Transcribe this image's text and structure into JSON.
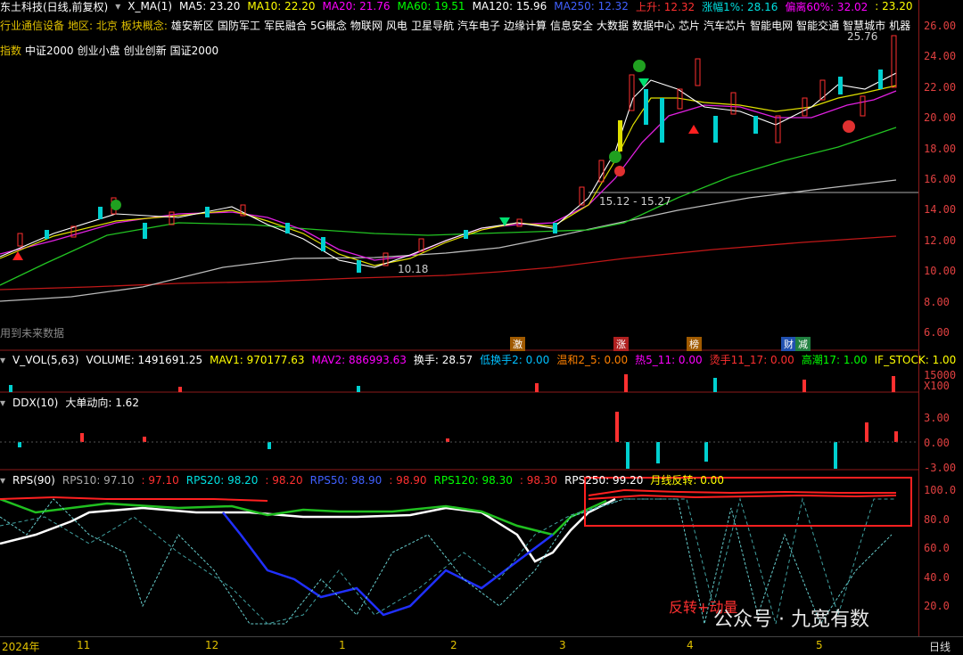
{
  "header": {
    "stock": "东土科技(日线,前复权)",
    "ma_label": "X_MA(1)",
    "ma_items": [
      {
        "text": "MA5: 23.20",
        "color": "#ffffff"
      },
      {
        "text": "MA10: 22.20",
        "color": "#ffff00"
      },
      {
        "text": "MA20: 21.76",
        "color": "#ff00ff"
      },
      {
        "text": "MA60: 19.51",
        "color": "#00ff00"
      },
      {
        "text": "MA120: 15.96",
        "color": "#ffffff"
      },
      {
        "text": "MA250: 12.32",
        "color": "#4060ff"
      },
      {
        "text": "上升: 12.32",
        "color": "#ff3030"
      },
      {
        "text": "涨幅1%: 28.16",
        "color": "#00e0e0"
      },
      {
        "text": "偏离60%: 32.02",
        "color": "#ff00ff"
      },
      {
        "text": ": 23.20",
        "color": "#ffff00"
      }
    ]
  },
  "sectors": {
    "industry": "行业通信设备",
    "region": "地区: 北京",
    "concept_prefix": "板块概念:",
    "concepts": [
      "雄安新区",
      "国防军工",
      "军民融合",
      "5G概念",
      "物联网",
      "风电",
      "卫星导航",
      "汽车电子",
      "边缘计算",
      "信息安全",
      "大数据",
      "数据中心",
      "芯片",
      "汽车芯片",
      "智能电网",
      "智能交通",
      "智慧城市",
      "机器"
    ],
    "index_label": "指数",
    "indices": [
      "中证2000",
      "创业小盘",
      "创业创新",
      "国证2000"
    ]
  },
  "main_chart": {
    "price_axis": [
      "26.00",
      "24.00",
      "22.00",
      "20.00",
      "18.00",
      "16.00",
      "14.00",
      "12.00",
      "10.00",
      "8.00",
      "6.00"
    ],
    "high_label": "25.76",
    "range_label": "15.12 - 15.27",
    "low_label": "10.18",
    "future_note": "用到未来数据",
    "tags": [
      {
        "text": "激",
        "bg": "#a05a00"
      },
      {
        "text": "涨",
        "bg": "#b02020"
      },
      {
        "text": "榜",
        "bg": "#a05a00"
      },
      {
        "text": "财",
        "bg": "#2050b0"
      },
      {
        "text": "减",
        "bg": "#208040"
      }
    ]
  },
  "volume": {
    "label": "V_VOL(5,63)",
    "items": [
      {
        "text": "VOLUME: 1491691.25",
        "color": "#ffffff"
      },
      {
        "text": "MAV1: 970177.63",
        "color": "#ffff00"
      },
      {
        "text": "MAV2: 886993.63",
        "color": "#ff00ff"
      },
      {
        "text": "换手: 28.57",
        "color": "#ffffff"
      },
      {
        "text": "低换手2: 0.00",
        "color": "#00c0ff"
      },
      {
        "text": "温和2_5: 0.00",
        "color": "#ff8000"
      },
      {
        "text": "热5_11: 0.00",
        "color": "#ff00ff"
      },
      {
        "text": "烫手11_17: 0.00",
        "color": "#ff3030"
      },
      {
        "text": "高潮17: 1.00",
        "color": "#00ff00"
      },
      {
        "text": "IF_STOCK: 1.00",
        "color": "#ffff00"
      }
    ],
    "axis": "15000",
    "unit": "X100"
  },
  "ddx": {
    "label": "DDX(10)",
    "item": "大单动向: 1.62",
    "axis": [
      "3.00",
      "0.00",
      "-3.00"
    ]
  },
  "rps": {
    "label": "RPS(90)",
    "items": [
      {
        "text": "RPS10: 97.10",
        "color": "#aaaaaa"
      },
      {
        "text": ": 97.10",
        "color": "#ff3030"
      },
      {
        "text": "RPS20: 98.20",
        "color": "#00e0e0"
      },
      {
        "text": ": 98.20",
        "color": "#ff3030"
      },
      {
        "text": "RPS50: 98.90",
        "color": "#4060ff"
      },
      {
        "text": ": 98.90",
        "color": "#ff3030"
      },
      {
        "text": "RPS120: 98.30",
        "color": "#00ff00"
      },
      {
        "text": ": 98.30",
        "color": "#ff3030"
      },
      {
        "text": "RPS250: 99.20",
        "color": "#ffffff"
      },
      {
        "text": "月线反转: 0.00",
        "color": "#ffff00"
      }
    ],
    "axis": [
      "100.0",
      "80.0",
      "60.0",
      "40.0",
      "20.0"
    ],
    "annotation": "反转+动量"
  },
  "watermark": "公众号 · 九宽有数",
  "dates": [
    "2024年",
    "11",
    "12",
    "1",
    "2",
    "3",
    "4",
    "5"
  ],
  "period": "日线"
}
